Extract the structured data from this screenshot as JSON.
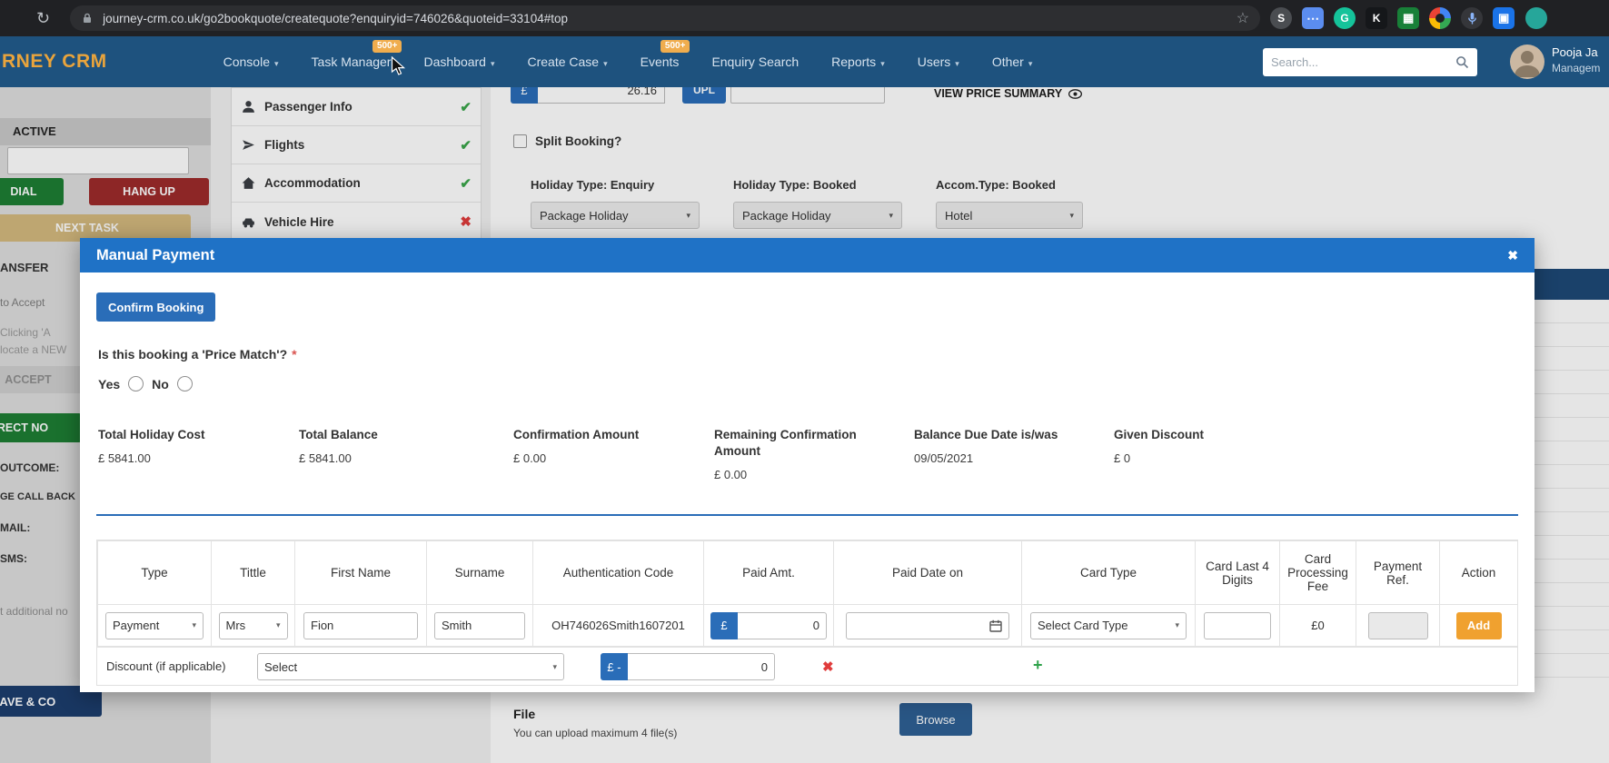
{
  "browser": {
    "url": "journey-crm.co.uk/go2bookquote/createquote?enquiryid=746026&quoteid=33104#top",
    "reload_icon": "↻",
    "star_icon": "☆",
    "ext": {
      "s": "S",
      "more": "⋯",
      "grammarly": "G",
      "kami": "K",
      "sheets": "▦",
      "apps": "▣"
    }
  },
  "ui": {
    "caret": "▾"
  },
  "navbar": {
    "brand": "RNEY CRM",
    "items": [
      {
        "label": "Console"
      },
      {
        "label": "Task Manager",
        "badge": "500+"
      },
      {
        "label": "Dashboard"
      },
      {
        "label": "Create Case"
      },
      {
        "label": "Events",
        "badge": "500+"
      },
      {
        "label": "Enquiry Search"
      },
      {
        "label": "Reports"
      },
      {
        "label": "Users"
      },
      {
        "label": "Other"
      }
    ],
    "search_placeholder": "Search...",
    "user_name": "Pooja Ja",
    "user_role": "Managem"
  },
  "sidebar": {
    "section_title": "ACTIVE",
    "dial_button": "DIAL",
    "hangup_button": "HANG UP",
    "next_task_button": "NEXT TASK",
    "transfer_label": "ANSFER",
    "accept_hint": "to Accept",
    "note_line1": "Clicking 'A",
    "note_line2": "locate a NEW",
    "accept_button": "ACCEPT",
    "correct_no_button": "RECT NO",
    "outcome_label": "OUTCOME:",
    "callback_label": "GE CALL BACK",
    "mail_label": "MAIL:",
    "sms_label": "SMS:",
    "additional_note": "t additional no",
    "save_button": "SAVE & CO"
  },
  "checklist": {
    "items": [
      {
        "label": "Passenger Info",
        "status_icon": "✔"
      },
      {
        "label": "Flights",
        "status_icon": "✔"
      },
      {
        "label": "Accommodation",
        "status_icon": "✔"
      },
      {
        "label": "Vehicle Hire",
        "status_icon": "✖"
      }
    ]
  },
  "content": {
    "currency": "£",
    "amount_value": "26.16",
    "upload_button": "UPL",
    "view_price_summary": "VIEW PRICE SUMMARY",
    "split_booking_label": "Split Booking?",
    "selects": [
      {
        "label": "Holiday Type: Enquiry",
        "value": "Package Holiday"
      },
      {
        "label": "Holiday Type: Booked",
        "value": "Package Holiday"
      },
      {
        "label": "Accom.Type: Booked",
        "value": "Hotel"
      }
    ],
    "file_label": "File",
    "file_hint": "You can upload maximum 4 file(s)",
    "browse_button": "Browse"
  },
  "modal": {
    "title": "Manual Payment",
    "close_icon": "✖",
    "confirm_button": "Confirm Booking",
    "price_match_question": "Is this booking a 'Price Match'?",
    "required_mark": "*",
    "radio_yes": "Yes",
    "radio_no": "No",
    "summary": [
      {
        "label": "Total Holiday Cost",
        "value": "£ 5841.00"
      },
      {
        "label": "Total Balance",
        "value": "£ 5841.00"
      },
      {
        "label": "Confirmation Amount",
        "value": "£ 0.00"
      },
      {
        "label": "Remaining Confirmation Amount",
        "value": "£ 0.00"
      },
      {
        "label": "Balance Due Date is/was",
        "value": "09/05/2021"
      },
      {
        "label": "Given Discount",
        "value": "£ 0"
      }
    ],
    "table": {
      "headers": [
        "Type",
        "Tittle",
        "First Name",
        "Surname",
        "Authentication Code",
        "Paid Amt.",
        "Paid Date on",
        "Card Type",
        "Card Last 4 Digits",
        "Card Processing Fee",
        "Payment Ref.",
        "Action"
      ],
      "row": {
        "type_value": "Payment",
        "title_value": "Mrs",
        "first_name": "Fion",
        "surname": "Smith",
        "auth_code": "OH746026Smith1607201",
        "currency": "£",
        "paid_amount": "0",
        "paid_date": "",
        "card_type_value": "Select Card Type",
        "card_last4": "",
        "processing_fee": "£0",
        "payment_ref": "",
        "add_button": "Add"
      },
      "discount": {
        "label": "Discount (if applicable)",
        "select_value": "Select",
        "currency_prefix": "£ -",
        "amount": "0",
        "remove_icon": "✖",
        "add_icon": "+"
      }
    }
  },
  "colors": {
    "nav_blue": "#1e527e",
    "modal_header_blue": "#1f72c6",
    "primary_blue": "#2a6db8",
    "accent_orange": "#f0a12f",
    "badge_orange": "#f0ad4e",
    "brand_orange": "#e9a43c",
    "success_green": "#3aa54a",
    "danger_red": "#e03c3c"
  }
}
